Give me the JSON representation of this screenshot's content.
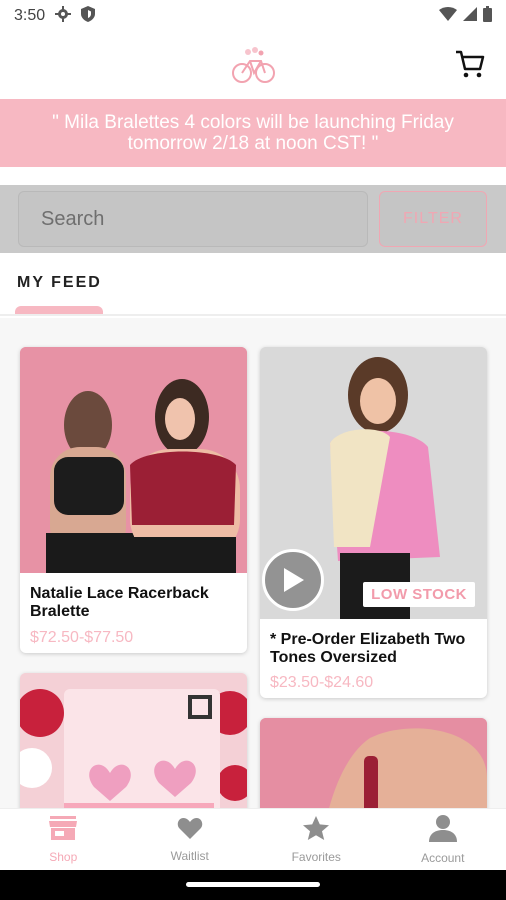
{
  "status_bar": {
    "time": "3:50",
    "icons": [
      "settings-gear-icon",
      "shield-icon",
      "wifi-icon",
      "signal-icon",
      "battery-icon"
    ]
  },
  "header": {
    "logo_icon": "bicycle-logo-icon",
    "cart_icon": "shopping-cart-icon"
  },
  "announcement": {
    "text": "\" Mila Bralettes 4 colors will be launching Friday tomorrow 2/18 at noon CST! \""
  },
  "search": {
    "placeholder": "Search",
    "filter_label": "FILTER"
  },
  "tabs": [
    {
      "label": "MY FEED",
      "active": true
    }
  ],
  "products": [
    {
      "title": "Natalie Lace Racerback Bralette",
      "price": "$72.50-$77.50",
      "badge": "",
      "has_video": false
    },
    {
      "title": "* Pre-Order Elizabeth Two Tones Oversized",
      "price": "$23.50-$24.60",
      "badge": "LOW STOCK",
      "has_video": true
    },
    {
      "title": "",
      "price": "",
      "badge": "",
      "has_video": false
    },
    {
      "title": "",
      "price": "",
      "badge": "",
      "has_video": false
    }
  ],
  "bottom_nav": [
    {
      "label": "Shop",
      "icon": "storefront-icon",
      "active": true
    },
    {
      "label": "Waitlist",
      "icon": "heart-icon",
      "active": false
    },
    {
      "label": "Favorites",
      "icon": "star-icon",
      "active": false
    },
    {
      "label": "Account",
      "icon": "person-icon",
      "active": false
    }
  ],
  "colors": {
    "accent_pink": "#f7b8c2",
    "price_pink": "#f7b8c2",
    "search_bg": "#c9c9c9",
    "nav_active": "#f5a9b6",
    "nav_inactive": "#9a9a9a"
  }
}
